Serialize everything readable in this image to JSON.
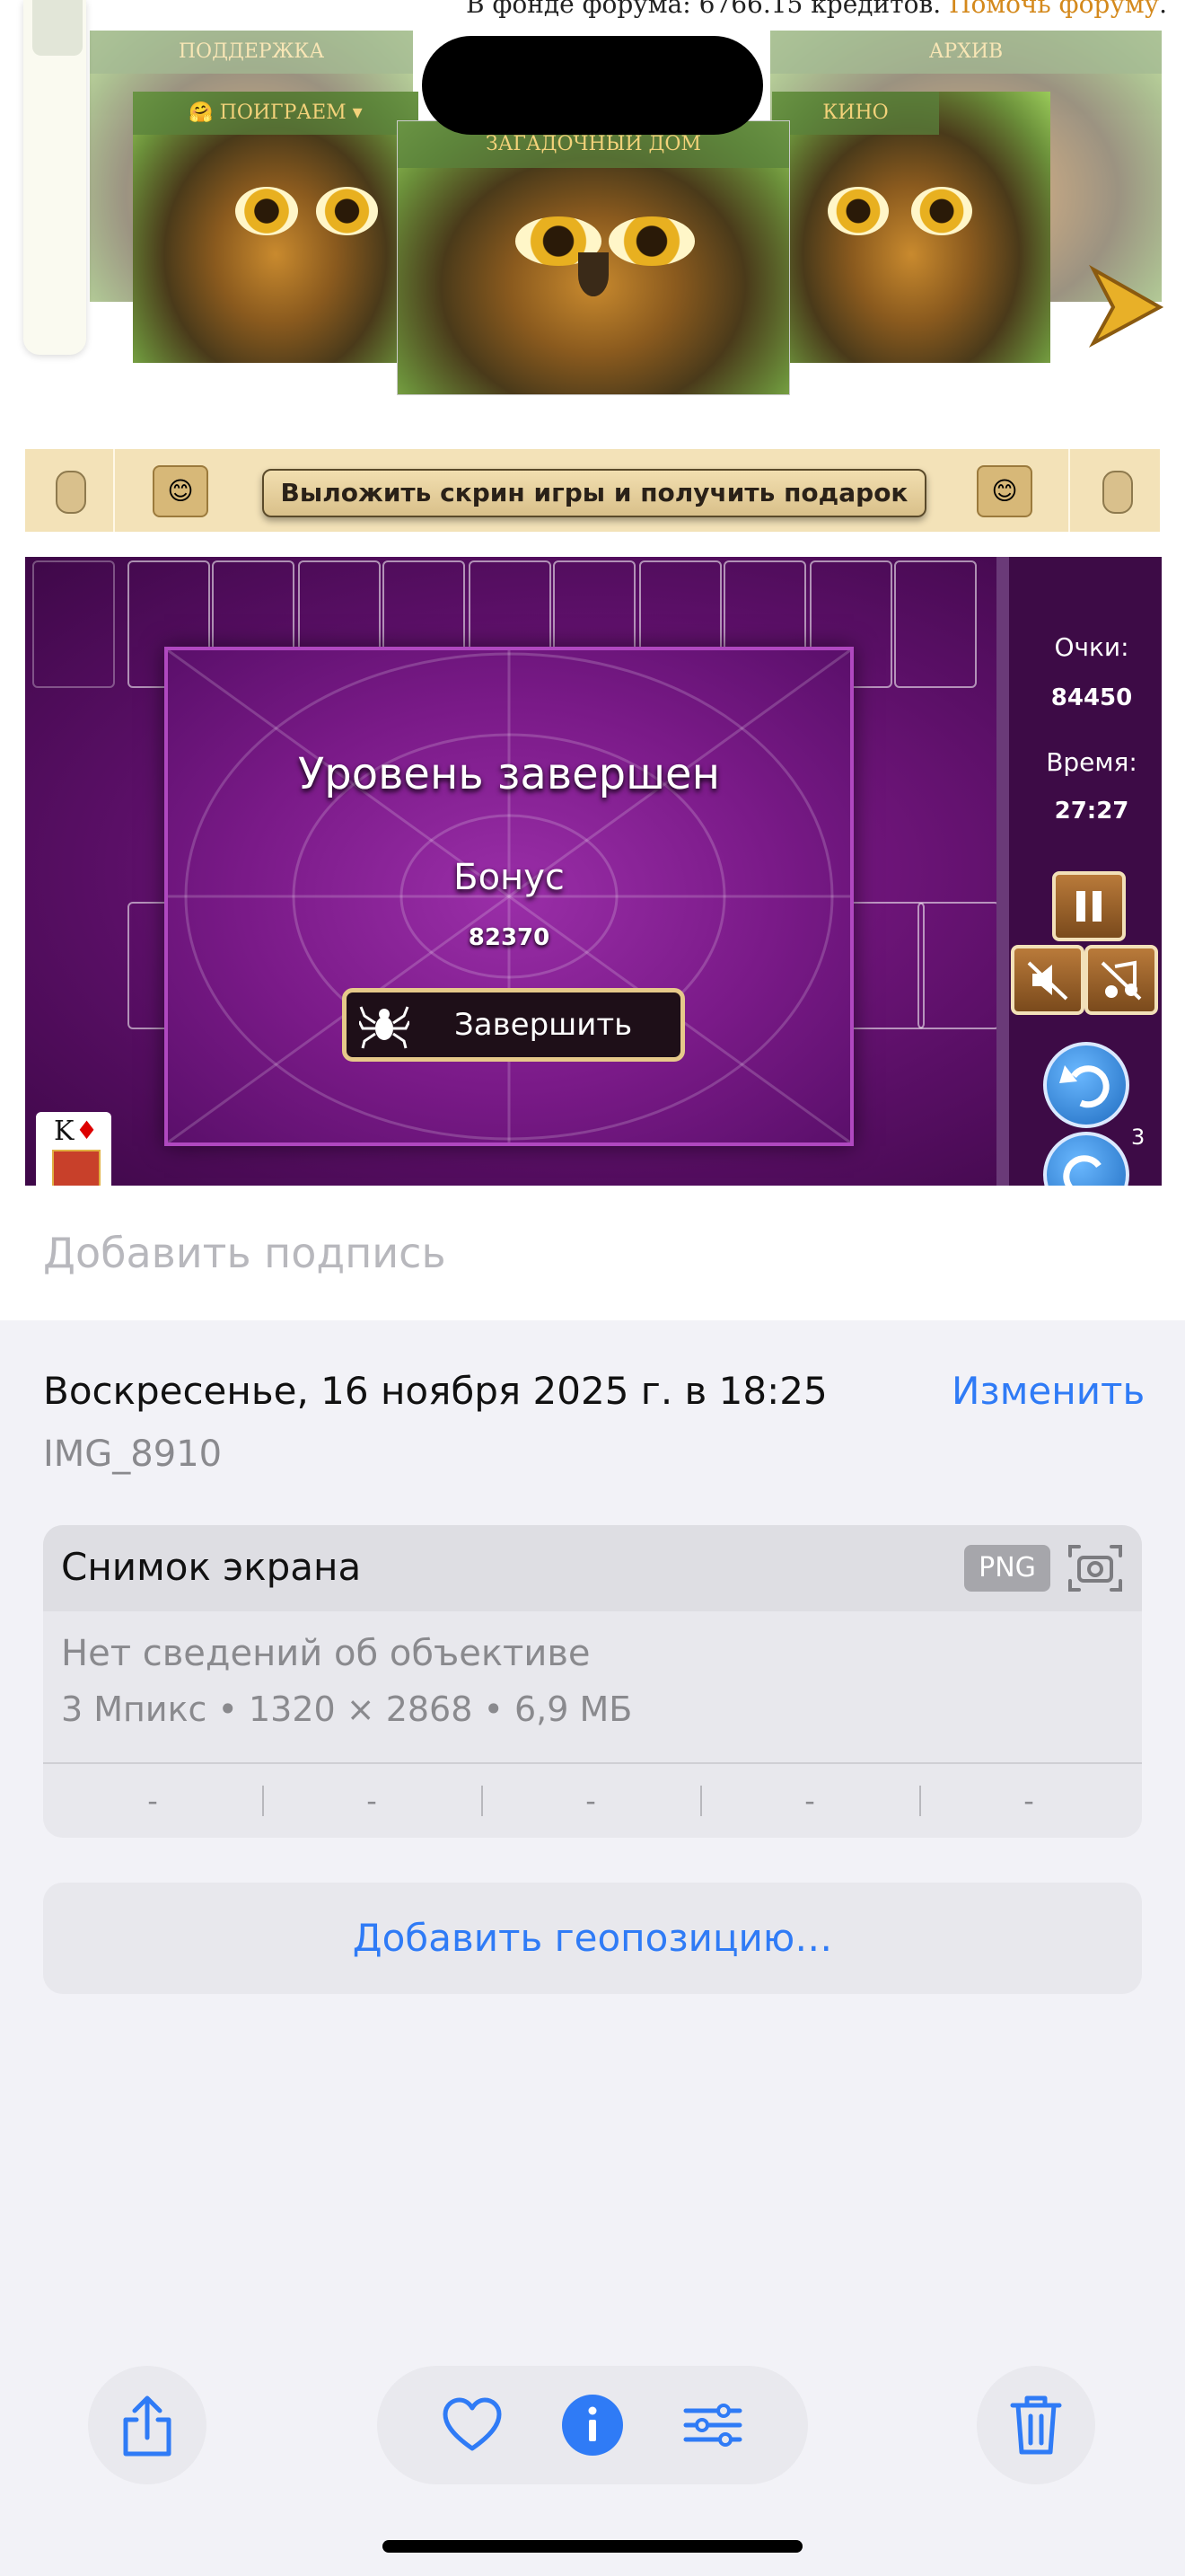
{
  "page": {
    "forum_text": "В фонде форума: 6766.15 кредитов.",
    "forum_link": "Помочь форуму",
    "forum_link_suffix": "."
  },
  "carousel": {
    "cards": [
      {
        "title": "ПОДДЕРЖКА"
      },
      {
        "title": "🤗 ПОИГРАЕМ ▾"
      },
      {
        "title": "ЗАГАДОЧНЫЙ ДОМ"
      },
      {
        "title": "КИНО"
      },
      {
        "title": "АРХИВ"
      }
    ]
  },
  "banner": {
    "button_label": "Выложить скрин игры и получить подарок",
    "emoji": "😊"
  },
  "game": {
    "score_label": "Очки:",
    "score_value": "84450",
    "time_label": "Время:",
    "time_value": "27:27",
    "undo_count": "3",
    "card_rank": "K",
    "card_suit": "♦",
    "dialog": {
      "title": "Уровень завершен",
      "bonus_label": "Бонус",
      "bonus_value": "82370",
      "finish_label": "Завершить"
    }
  },
  "photo_info": {
    "caption_placeholder": "Добавить подпись",
    "date": "Воскресенье, 16 ноября 2025 г. в 18:25",
    "edit_label": "Изменить",
    "filename": "IMG_8910",
    "kind": "Снимок экрана",
    "format_badge": "PNG",
    "lens": "Нет сведений об объективе",
    "specs": "3 Мпикс • 1320 × 2868 • 6,9 МБ",
    "exif_cells": [
      "-",
      "-",
      "-",
      "-",
      "-"
    ],
    "geo_button": "Добавить геопозицию…"
  },
  "colors": {
    "accent": "#2f7bf6",
    "link_orange": "#d4891c",
    "game_purple": "#5a0f66"
  },
  "icons": [
    "share-icon",
    "heart-icon",
    "info-icon",
    "adjust-icon",
    "trash-icon",
    "camera-icon",
    "spider-icon"
  ]
}
